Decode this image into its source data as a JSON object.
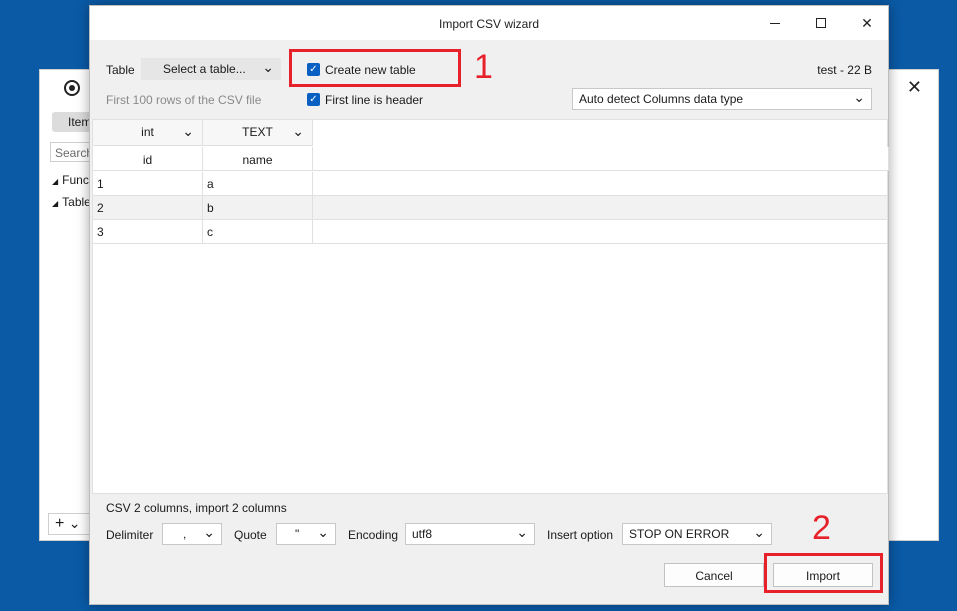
{
  "background_window": {
    "items_tab": "Items",
    "search_placeholder": "Search",
    "tree": [
      "Functions",
      "Tables"
    ],
    "add_label": "+",
    "close": "✕"
  },
  "dialog": {
    "title": "Import CSV wizard",
    "window_controls": {
      "minimize": "minimize-icon",
      "maximize": "maximize-icon",
      "close": "✕"
    },
    "table_label": "Table",
    "table_select": "Select a table...",
    "create_new_table": {
      "label": "Create new table",
      "checked": true
    },
    "first_line_header": {
      "label": "First line is header",
      "checked": true
    },
    "file_info": "test - 22 B",
    "preview_hint": "First 100 rows of the CSV file",
    "detect_select": "Auto detect Columns data type",
    "grid": {
      "types": [
        "int",
        "TEXT"
      ],
      "columns": [
        "id",
        "name"
      ],
      "rows": [
        [
          "1",
          "a"
        ],
        [
          "2",
          "b"
        ],
        [
          "3",
          "c"
        ]
      ]
    },
    "summary": "CSV 2 columns, import 2 columns",
    "delimiter": {
      "label": "Delimiter",
      "value": ","
    },
    "quote": {
      "label": "Quote",
      "value": "\""
    },
    "encoding": {
      "label": "Encoding",
      "value": "utf8"
    },
    "insert_option": {
      "label": "Insert option",
      "value": "STOP ON ERROR"
    },
    "cancel": "Cancel",
    "import": "Import"
  },
  "annotations": [
    "1",
    "2"
  ],
  "colors": {
    "annotation": "#e8202a",
    "checkbox": "#0a5fc2",
    "desktop": "#0a5aa6"
  }
}
